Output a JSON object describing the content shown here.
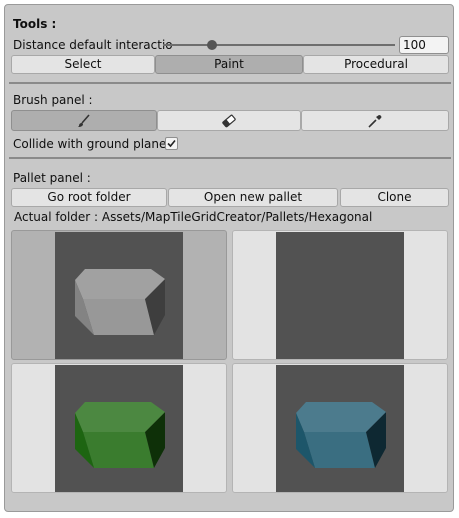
{
  "tools": {
    "heading": "Tools :",
    "distance_label": "Distance default interactio",
    "distance_value": "100",
    "distance_slider_level": 0.21,
    "modes": [
      {
        "label": "Select",
        "active": false
      },
      {
        "label": "Paint",
        "active": true
      },
      {
        "label": "Procedural",
        "active": false
      }
    ]
  },
  "brush": {
    "heading": "Brush panel :",
    "tools": [
      {
        "icon": "brush-icon",
        "active": true
      },
      {
        "icon": "eraser-icon",
        "active": false
      },
      {
        "icon": "eyedropper-icon",
        "active": false
      }
    ],
    "collide_label": "Collide with ground plane :",
    "collide_checked": true
  },
  "pallet": {
    "heading": "Pallet panel :",
    "buttons": {
      "root": "Go root folder",
      "open": "Open new pallet",
      "clone": "Clone"
    },
    "folder_path": "Actual folder : Assets/MapTileGridCreator/Pallets/Hexagonal",
    "tiles": [
      {
        "name": "hexagon-gray",
        "color": "#8a8a8a",
        "selected": true,
        "empty": false
      },
      {
        "name": "empty",
        "color": "",
        "selected": false,
        "empty": true
      },
      {
        "name": "hexagon-green",
        "color": "#1f6a12",
        "selected": false,
        "empty": false
      },
      {
        "name": "hexagon-blue",
        "color": "#1f5a70",
        "selected": false,
        "empty": false
      }
    ]
  },
  "colors": {
    "panel_bg": "#c8c8c8",
    "button_bg": "#e4e4e4",
    "button_active_bg": "#aeaeae",
    "preview_bg": "#525252"
  }
}
